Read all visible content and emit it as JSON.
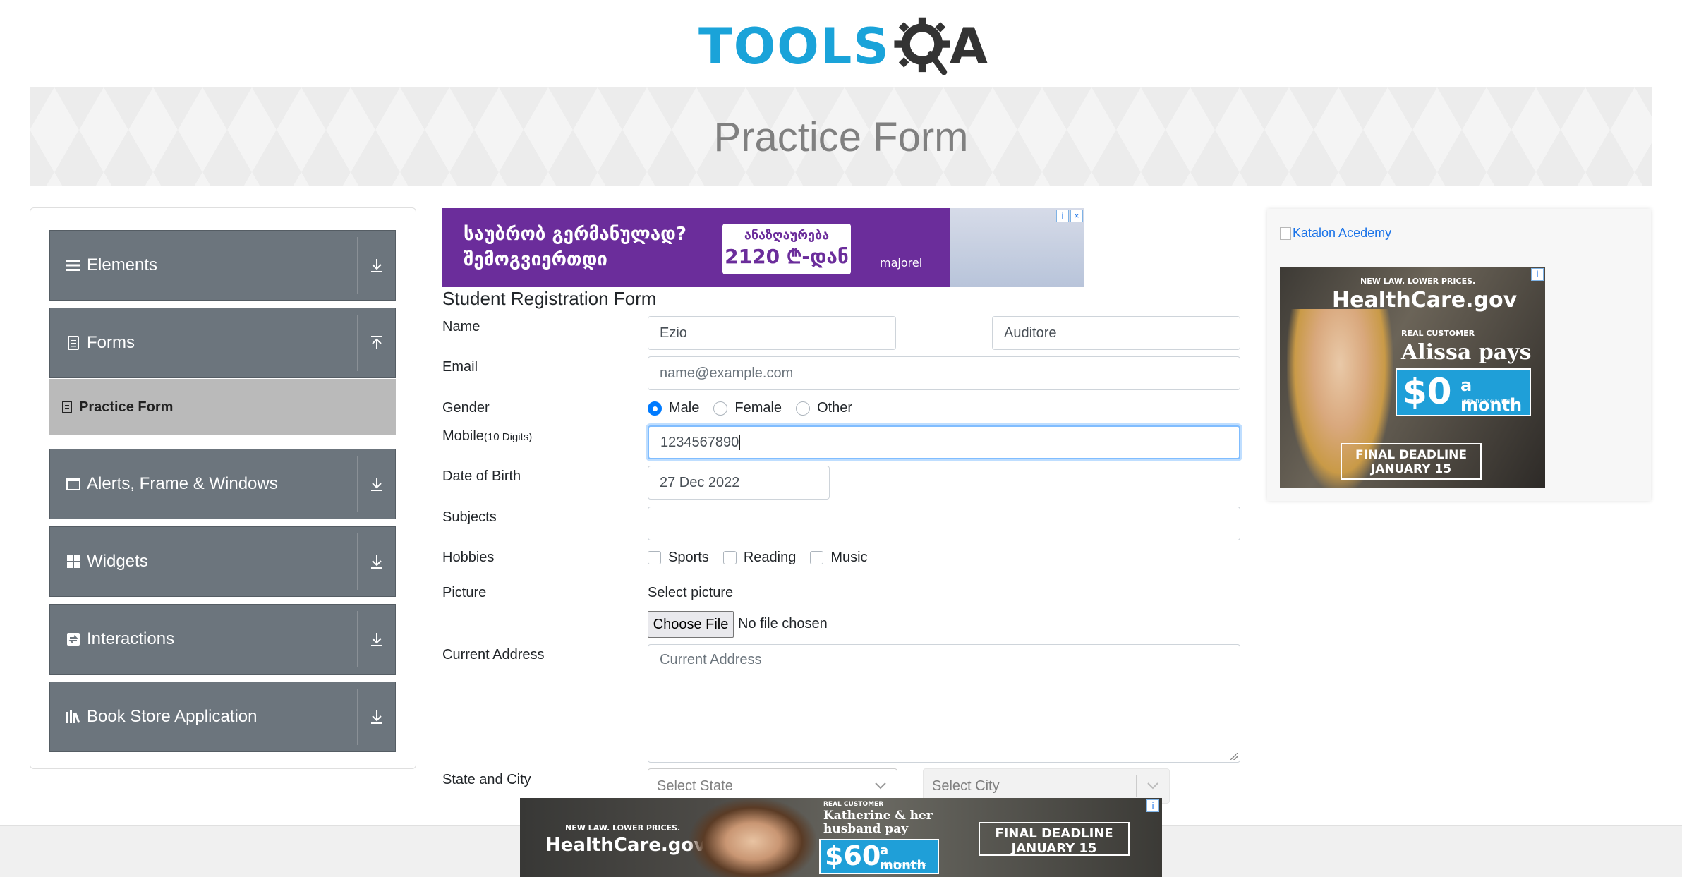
{
  "header": {
    "logo_text_tools": "TOOLS",
    "logo_text_a": "A",
    "page_title": "Practice Form"
  },
  "sidebar": {
    "groups": [
      {
        "label": "Elements",
        "icon": "hamburger-icon",
        "state": "collapsed"
      },
      {
        "label": "Forms",
        "icon": "document-icon",
        "state": "expanded"
      },
      {
        "label": "Alerts, Frame & Windows",
        "icon": "window-icon",
        "state": "collapsed"
      },
      {
        "label": "Widgets",
        "icon": "grid-icon",
        "state": "collapsed"
      },
      {
        "label": "Interactions",
        "icon": "interaction-icon",
        "state": "collapsed"
      },
      {
        "label": "Book Store Application",
        "icon": "books-icon",
        "state": "collapsed"
      }
    ],
    "active_item": "Practice Form"
  },
  "ad_top": {
    "line1": "საუბრობ გერმანულად?",
    "line2": "შემოგვიერთდი",
    "price_line1": "ანაზღაურება",
    "price_line2": "2120 ₾-დან",
    "brand": "majorel"
  },
  "form": {
    "title": "Student Registration Form",
    "labels": {
      "name": "Name",
      "email": "Email",
      "gender": "Gender",
      "mobile": "Mobile",
      "mobile_hint": "(10 Digits)",
      "dob": "Date of Birth",
      "subjects": "Subjects",
      "hobbies": "Hobbies",
      "picture": "Picture",
      "address": "Current Address",
      "state_city": "State and City"
    },
    "first_name": "Ezio",
    "last_name": "Auditore",
    "email_placeholder": "name@example.com",
    "genders": [
      "Male",
      "Female",
      "Other"
    ],
    "selected_gender": "Male",
    "mobile": "1234567890",
    "dob": "27 Dec 2022",
    "subjects": "",
    "hobbies": [
      "Sports",
      "Reading",
      "Music"
    ],
    "picture_label": "Select picture",
    "file_button": "Choose File",
    "file_status": "No file chosen",
    "address_placeholder": "Current Address",
    "state_placeholder": "Select State",
    "city_placeholder": "Select City"
  },
  "right_ad": {
    "link_text": "Katalon Acedemy",
    "new_law": "NEW LAW. LOWER PRICES.",
    "brand": "HealthCare.gov",
    "real_customer": "REAL CUSTOMER",
    "headline": "Alissa pays",
    "amount": "$0",
    "per": "a month",
    "fine_print": "with financial help",
    "deadline1": "FINAL DEADLINE",
    "deadline2": "JANUARY 15"
  },
  "bottom_ad": {
    "new_law": "NEW LAW. LOWER PRICES.",
    "brand": "HealthCare.gov",
    "real_customer": "REAL CUSTOMER",
    "headline": "Katherine & her husband pay",
    "amount": "$60",
    "per": "a month",
    "fine_print": "with financial help",
    "deadline1": "FINAL DEADLINE",
    "deadline2": "JANUARY 15"
  },
  "colors": {
    "logo_blue": "#1aa3d9",
    "nav_group_bg": "#6c757d",
    "active_item_bg": "#bababa",
    "radio_checked": "#007bff",
    "focus_border": "#80bdff"
  }
}
